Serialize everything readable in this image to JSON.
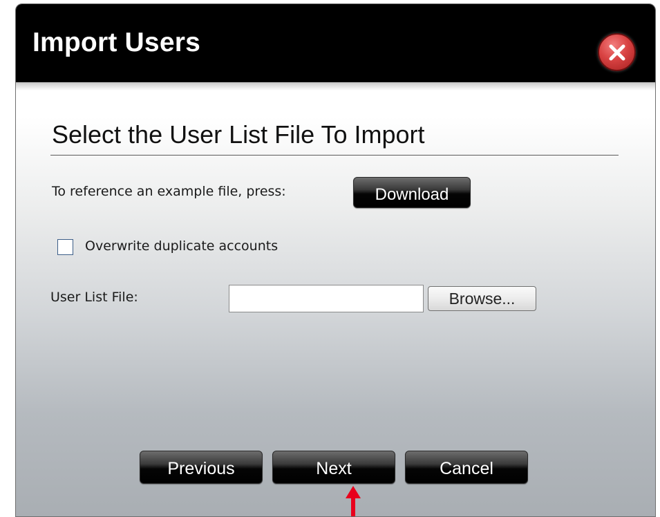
{
  "dialog": {
    "title": "Import Users",
    "close_icon": "close-icon"
  },
  "section": {
    "title": "Select the User List File To Import"
  },
  "download_row": {
    "label": "To reference an example file, press:",
    "button_label": "Download"
  },
  "overwrite": {
    "label": "Overwrite duplicate accounts",
    "checked": false
  },
  "file_row": {
    "label": "User List File:",
    "value": "",
    "browse_label": "Browse..."
  },
  "footer": {
    "previous_label": "Previous",
    "next_label": "Next",
    "cancel_label": "Cancel"
  },
  "annotation": {
    "icon": "arrow-up-icon",
    "color": "#e8001c"
  }
}
